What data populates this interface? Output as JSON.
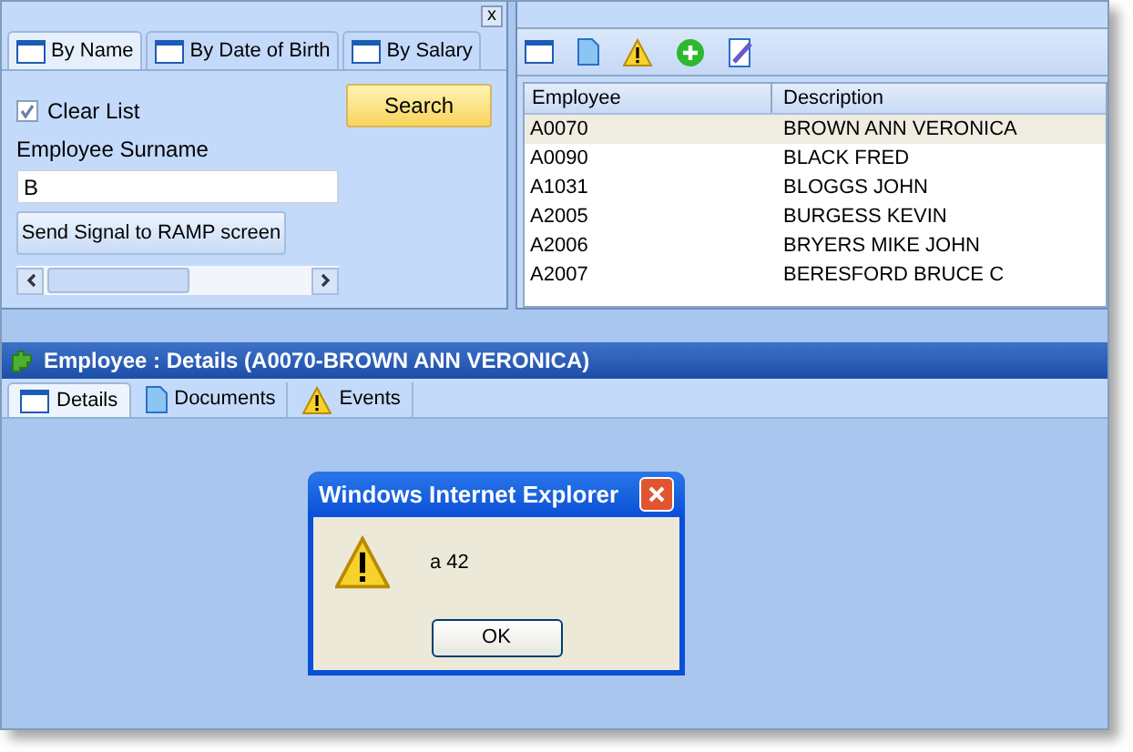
{
  "search_panel": {
    "close": "x",
    "tabs": [
      {
        "label": "By Name",
        "selected": true
      },
      {
        "label": "By Date of Birth",
        "selected": false
      },
      {
        "label": "By Salary",
        "selected": false
      }
    ],
    "clear_list": {
      "label": "Clear List",
      "checked": true
    },
    "search_button": "Search",
    "surname": {
      "label": "Employee Surname",
      "value": "B"
    },
    "signal_button": "Send Signal to RAMP screen"
  },
  "results": {
    "columns": [
      "Employee",
      "Description"
    ],
    "rows": [
      {
        "employee": "A0070",
        "description": "BROWN ANN VERONICA",
        "selected": true
      },
      {
        "employee": "A0090",
        "description": "BLACK FRED",
        "selected": false
      },
      {
        "employee": "A1031",
        "description": "BLOGGS JOHN",
        "selected": false
      },
      {
        "employee": "A2005",
        "description": "BURGESS KEVIN",
        "selected": false
      },
      {
        "employee": "A2006",
        "description": "BRYERS MIKE JOHN",
        "selected": false
      },
      {
        "employee": "A2007",
        "description": "BERESFORD BRUCE C",
        "selected": false
      }
    ]
  },
  "details": {
    "title": "Employee : Details (A0070-BROWN ANN VERONICA)",
    "tabs": [
      {
        "label": "Details",
        "kind": "window",
        "selected": true
      },
      {
        "label": "Documents",
        "kind": "document",
        "selected": false
      },
      {
        "label": "Events",
        "kind": "warning",
        "selected": false
      }
    ]
  },
  "dialog": {
    "title": "Windows Internet Explorer",
    "message": "a 42",
    "button": "OK"
  }
}
